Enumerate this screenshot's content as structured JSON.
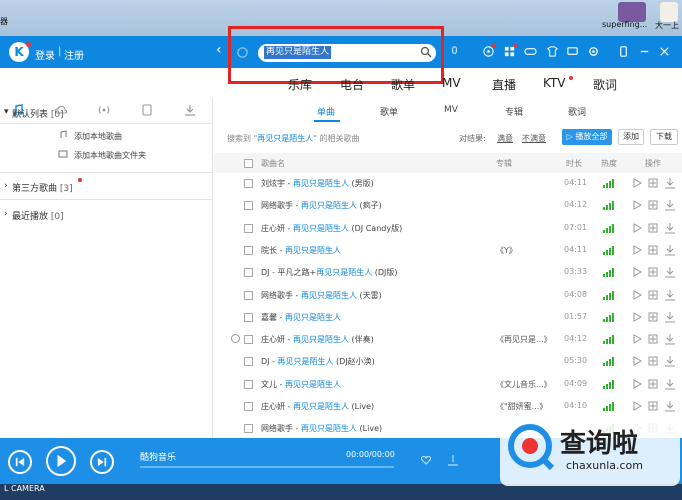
{
  "desktop": {
    "left_label": "器",
    "icon1_label": "superfing...",
    "icon2_label": "大一上"
  },
  "header": {
    "login": "登录",
    "separator": "|",
    "register": "注册",
    "search_value": "再见只是陌生人"
  },
  "categories": [
    "乐库",
    "电台",
    "歌单",
    "MV",
    "直播",
    "KTV",
    "歌词"
  ],
  "sidebar": {
    "default_list": {
      "title": "默认列表",
      "count": "[0]"
    },
    "add_song": "添加本地歌曲",
    "add_folder": "添加本地歌曲文件夹",
    "third_party": {
      "title": "第三方歌曲",
      "count": "[3]"
    },
    "recent": {
      "title": "最近播放",
      "count": "[0]"
    }
  },
  "subtabs": [
    "单曲",
    "歌单",
    "MV",
    "专辑",
    "歌词"
  ],
  "result": {
    "prefix": "搜索到 \"",
    "keyword": "再见只是陌生人",
    "suffix": "\" 的相关歌曲",
    "feedback_label": "对结果:",
    "satisfied": "满意",
    "unsatisfied": "不满意",
    "play_all": "播放全部",
    "add": "添加",
    "download": "下载"
  },
  "table": {
    "headers": {
      "name": "歌曲名",
      "album": "专辑",
      "duration": "时长",
      "heat": "热度",
      "ops": "操作"
    },
    "rows": [
      {
        "artist": "刘炫宇 - ",
        "song": "再见只是陌生人",
        "extra": " (男版)",
        "album": "",
        "duration": "04:11"
      },
      {
        "artist": "网络歌手 - ",
        "song": "再见只是陌生人",
        "extra": " (疯子)",
        "album": "",
        "duration": "04:12"
      },
      {
        "artist": "庄心妍 - ",
        "song": "再见只是陌生人",
        "extra": " (DJ Candy版)",
        "album": "",
        "duration": "07:01"
      },
      {
        "artist": "院长 - ",
        "song": "再见只是陌生人",
        "extra": "",
        "album": "《Y》",
        "duration": "04:11"
      },
      {
        "artist": "DJ - 平凡之路+",
        "song": "再见只是陌生人",
        "extra": " (DJ版)",
        "album": "",
        "duration": "03:33"
      },
      {
        "artist": "网络歌手 - ",
        "song": "再见只是陌生人",
        "extra": " (天雷)",
        "album": "",
        "duration": "04:08"
      },
      {
        "artist": "嘉馨 - ",
        "song": "再见只是陌生人",
        "extra": "",
        "album": "",
        "duration": "01:57"
      },
      {
        "artist": "庄心妍 - ",
        "song": "再见只是陌生人",
        "extra": " (伴奏)",
        "album": "《再见只是...》",
        "duration": "04:12"
      },
      {
        "artist": "DJ - ",
        "song": "再见只是陌生人",
        "extra": " (DJ赵小涣)",
        "album": "",
        "duration": "05:30"
      },
      {
        "artist": "文儿 - ",
        "song": "再见只是陌生人",
        "extra": "",
        "album": "《文儿音乐...》",
        "duration": "04:09"
      },
      {
        "artist": "庄心妍 - ",
        "song": "再见只是陌生人",
        "extra": " (Live)",
        "album": "《\"甜妍蜜...》",
        "duration": "04:10"
      },
      {
        "artist": "网络歌手 - ",
        "song": "再见只是陌生人",
        "extra": " (Live)",
        "album": "",
        "duration": ""
      }
    ]
  },
  "player": {
    "title": "酷狗音乐",
    "time": "00:00/00:00"
  },
  "taskbar": {
    "label": "L CAMERA"
  },
  "watermark": {
    "main": "查询啦",
    "sub": "chaxunla.com"
  },
  "colors": {
    "brand": "#0d87e0",
    "highlight": "#e02323",
    "heat": "#2fb32f"
  }
}
